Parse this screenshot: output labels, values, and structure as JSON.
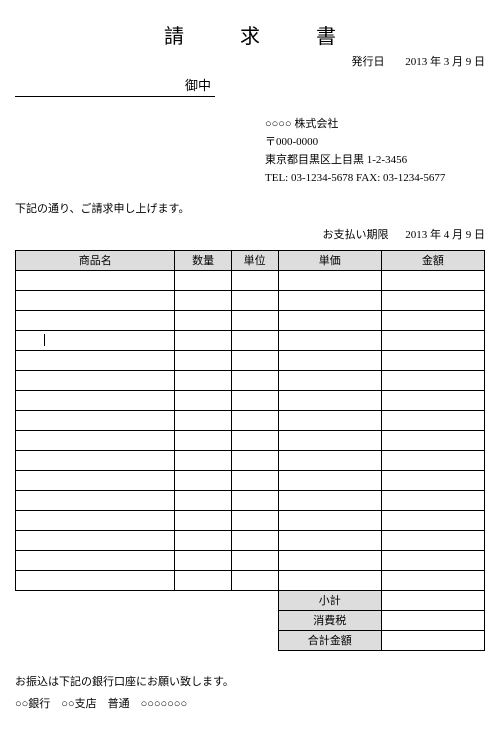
{
  "title": "請　求　書",
  "issue": {
    "label": "発行日",
    "date": "2013 年 3 月 9 日"
  },
  "addressee_suffix": "御中",
  "sender": {
    "company": "○○○○ 株式会社",
    "postal": "〒000-0000",
    "address": "東京都目黒区上目黒 1-2-3456",
    "contact": "TEL: 03-1234-5678  FAX: 03-1234-5677"
  },
  "note": "下記の通り、ご請求申し上げます。",
  "due": {
    "label": "お支払い期限",
    "date": "2013 年 4 月 9 日"
  },
  "columns": {
    "name": "商品名",
    "qty": "数量",
    "unit": "単位",
    "price": "単価",
    "amount": "金額"
  },
  "summary": {
    "subtotal": "小計",
    "tax": "消費税",
    "total": "合計金額"
  },
  "footer": {
    "bank_note": "お振込は下記の銀行口座にお願い致します。",
    "bank_info": "○○銀行　○○支店　普通　○○○○○○○"
  }
}
